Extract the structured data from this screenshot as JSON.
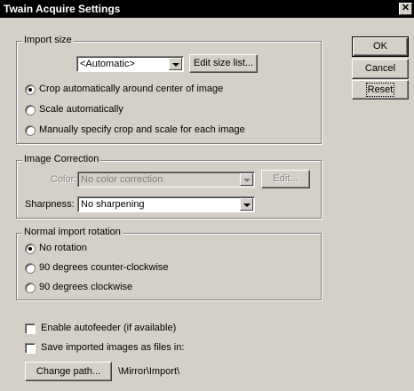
{
  "window": {
    "title": "Twain Acquire Settings",
    "close_glyph": "✕"
  },
  "import_size": {
    "legend": "Import size",
    "size_select": "<Automatic>",
    "edit_size_list": "Edit size list...",
    "options": [
      {
        "label": "Crop automatically around center of image",
        "checked": true
      },
      {
        "label": "Scale automatically",
        "checked": false
      },
      {
        "label": "Manually specify crop and scale for each image",
        "checked": false
      }
    ]
  },
  "image_correction": {
    "legend": "Image Correction",
    "color_label": "Color:",
    "color_value": "No color correction",
    "edit_button": "Edit...",
    "sharpness_label": "Sharpness:",
    "sharpness_value": "No sharpening"
  },
  "rotation": {
    "legend": "Normal import rotation",
    "options": [
      {
        "label": "No rotation",
        "checked": true
      },
      {
        "label": "90 degrees counter-clockwise",
        "checked": false
      },
      {
        "label": "90 degrees clockwise",
        "checked": false
      }
    ]
  },
  "autofeeder_label": "Enable autofeeder (if available)",
  "save_files_label": "Save imported images as files in:",
  "change_path_button": "Change path...",
  "path_value": "\\Mirror\\Import\\",
  "buttons": {
    "ok": "OK",
    "cancel": "Cancel",
    "reset": "Reset"
  },
  "colors": {
    "titlebar": "#000000",
    "face": "#d4d0c8",
    "disabled_text": "#808080"
  }
}
